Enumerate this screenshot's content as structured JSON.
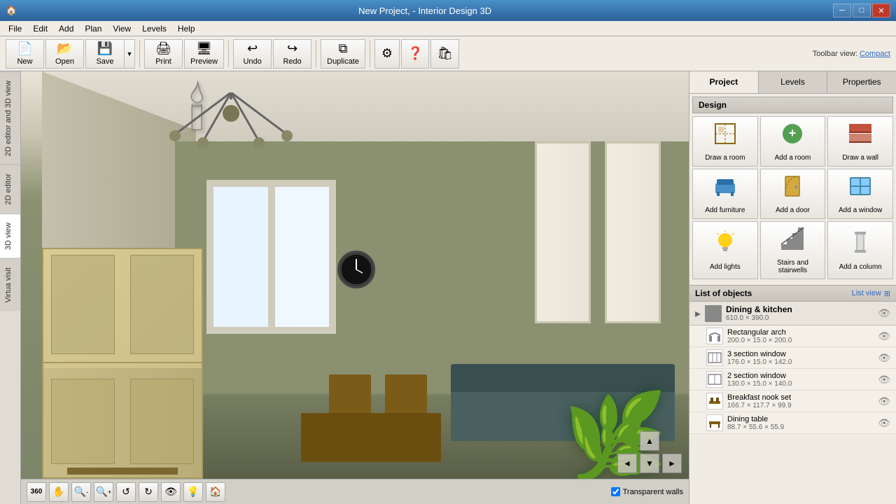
{
  "window": {
    "title": "New Project, - Interior Design 3D",
    "app_icon": "🏠"
  },
  "titlebar": {
    "minimize": "─",
    "restore": "□",
    "close": "✕"
  },
  "menubar": {
    "items": [
      "File",
      "Edit",
      "Add",
      "Plan",
      "View",
      "Levels",
      "Help"
    ]
  },
  "toolbar": {
    "buttons": [
      {
        "id": "new",
        "label": "New",
        "icon": "📄"
      },
      {
        "id": "open",
        "label": "Open",
        "icon": "📂"
      },
      {
        "id": "save",
        "label": "Save",
        "icon": "💾"
      },
      {
        "id": "print",
        "label": "Print",
        "icon": "🖨"
      },
      {
        "id": "preview",
        "label": "Preview",
        "icon": "🖥"
      },
      {
        "id": "undo",
        "label": "Undo",
        "icon": "↩"
      },
      {
        "id": "redo",
        "label": "Redo",
        "icon": "↪"
      },
      {
        "id": "duplicate",
        "label": "Duplicate",
        "icon": "⧉"
      },
      {
        "id": "settings",
        "label": "⚙",
        "icon": "⚙"
      },
      {
        "id": "help",
        "label": "?",
        "icon": "?"
      },
      {
        "id": "bag",
        "label": "🛍",
        "icon": "🛍"
      }
    ],
    "compact_label": "Toolbar view:",
    "compact_link": "Compact"
  },
  "left_tabs": [
    {
      "id": "2d-3d",
      "label": "2D editor and 3D view"
    },
    {
      "id": "2d",
      "label": "2D editor"
    },
    {
      "id": "3d",
      "label": "3D view"
    },
    {
      "id": "virtual",
      "label": "Virtua visit"
    }
  ],
  "viewport": {
    "transparent_walls_label": "Transparent walls",
    "transparent_walls_checked": true
  },
  "bottom_tools": [
    {
      "id": "360",
      "icon": "360",
      "label": "360"
    },
    {
      "id": "pan",
      "icon": "✋",
      "label": "Pan"
    },
    {
      "id": "zoom-out",
      "icon": "🔍-",
      "label": "Zoom out"
    },
    {
      "id": "zoom-in",
      "icon": "🔍+",
      "label": "Zoom in"
    },
    {
      "id": "orbit",
      "icon": "↺",
      "label": "Orbit"
    },
    {
      "id": "rotate",
      "icon": "↻",
      "label": "Rotate"
    },
    {
      "id": "look",
      "icon": "👁",
      "label": "Look"
    },
    {
      "id": "light",
      "icon": "💡",
      "label": "Light"
    },
    {
      "id": "home",
      "icon": "🏠",
      "label": "Home"
    }
  ],
  "panel": {
    "tabs": [
      {
        "id": "project",
        "label": "Project",
        "active": true
      },
      {
        "id": "levels",
        "label": "Levels",
        "active": false
      },
      {
        "id": "properties",
        "label": "Properties",
        "active": false
      }
    ],
    "design_section_label": "Design",
    "design_buttons": [
      {
        "id": "draw-room",
        "label": "Draw a room",
        "icon": "🏠"
      },
      {
        "id": "add-room",
        "label": "Add a room",
        "icon": "➕"
      },
      {
        "id": "draw-wall",
        "label": "Draw a wall",
        "icon": "🧱"
      },
      {
        "id": "add-furniture",
        "label": "Add furniture",
        "icon": "🪑"
      },
      {
        "id": "add-door",
        "label": "Add a door",
        "icon": "🚪"
      },
      {
        "id": "add-window",
        "label": "Add a window",
        "icon": "🪟"
      },
      {
        "id": "add-lights",
        "label": "Add lights",
        "icon": "💡"
      },
      {
        "id": "stairs",
        "label": "Stairs and stairwells",
        "icon": "🪜"
      },
      {
        "id": "add-column",
        "label": "Add a column",
        "icon": "⌧"
      }
    ],
    "list_header": "List of objects",
    "list_view_label": "List view",
    "objects": {
      "group": {
        "name": "Dining & kitchen",
        "dims": "610.0 × 390.0"
      },
      "items": [
        {
          "name": "Rectangular arch",
          "dims": "200.0 × 15.0 × 200.0"
        },
        {
          "name": "3 section window",
          "dims": "176.0 × 15.0 × 142.0"
        },
        {
          "name": "2 section window",
          "dims": "130.0 × 15.0 × 140.0"
        },
        {
          "name": "Breakfast nook set",
          "dims": "166.7 × 117.7 × 99.9"
        },
        {
          "name": "Dining table",
          "dims": "88.7 × 55.6 × 55.9"
        }
      ]
    }
  }
}
